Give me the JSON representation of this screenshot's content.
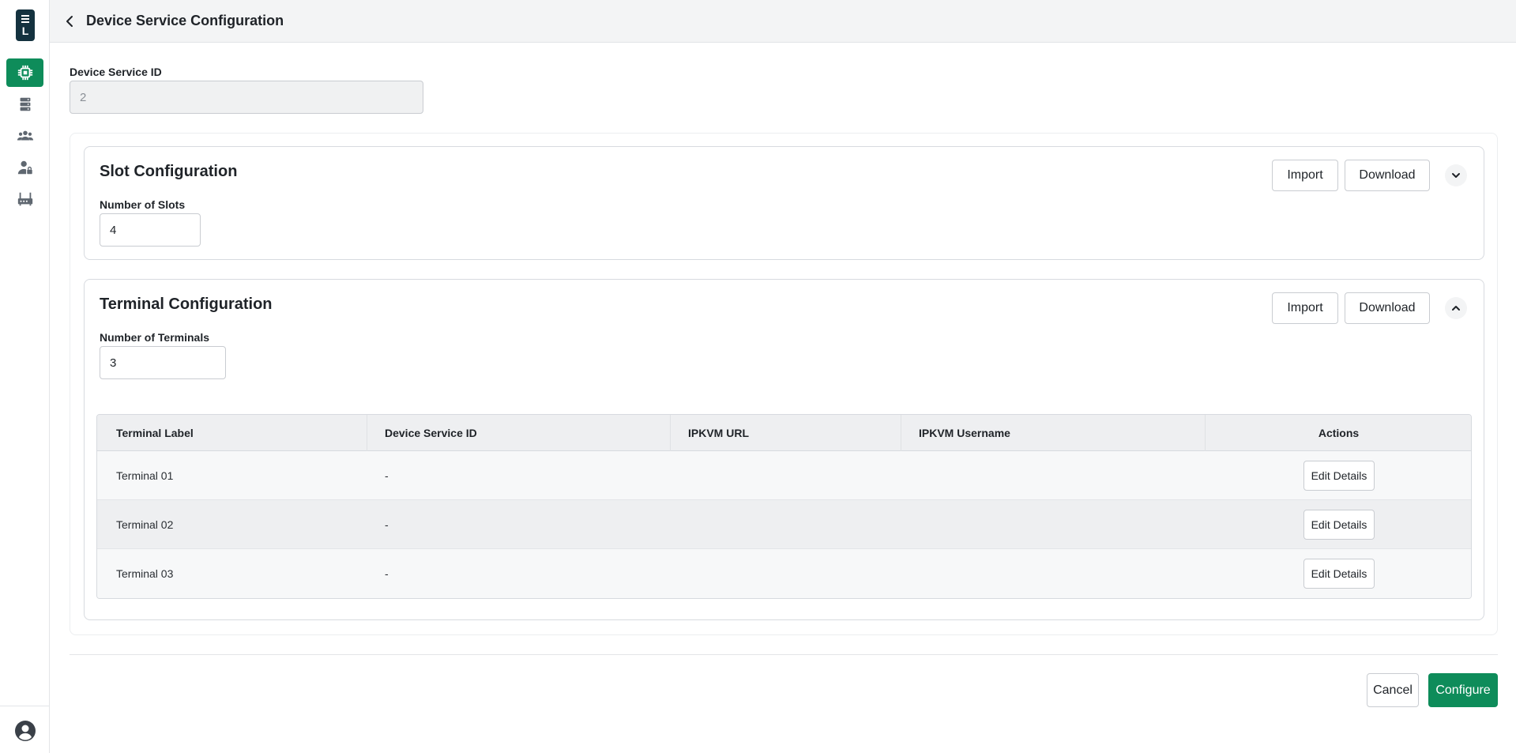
{
  "app": {
    "logo_letter": "L"
  },
  "sidebar": {
    "items": [
      {
        "icon": "chip-icon",
        "active": true
      },
      {
        "icon": "server-icon",
        "active": false
      },
      {
        "icon": "users-icon",
        "active": false
      },
      {
        "icon": "user-lock-icon",
        "active": false
      },
      {
        "icon": "router-icon",
        "active": false
      }
    ],
    "accent_color": "#0e8c5a"
  },
  "header": {
    "title": "Device Service Configuration"
  },
  "device_service": {
    "label": "Device Service ID",
    "value": "2"
  },
  "slot_config": {
    "title": "Slot Configuration",
    "import_label": "Import",
    "download_label": "Download",
    "count_label": "Number of Slots",
    "count_value": "4",
    "expanded": false
  },
  "terminal_config": {
    "title": "Terminal Configuration",
    "import_label": "Import",
    "download_label": "Download",
    "count_label": "Number of Terminals",
    "count_value": "3",
    "expanded": true,
    "table": {
      "headers": [
        "Terminal Label",
        "Device Service ID",
        "IPKVM URL",
        "IPKVM Username",
        "Actions"
      ],
      "rows": [
        {
          "label": "Terminal 01",
          "device_service_id": "-",
          "ipkvm_url": "",
          "ipkvm_username": "",
          "action": "Edit Details"
        },
        {
          "label": "Terminal 02",
          "device_service_id": "-",
          "ipkvm_url": "",
          "ipkvm_username": "",
          "action": "Edit Details"
        },
        {
          "label": "Terminal 03",
          "device_service_id": "-",
          "ipkvm_url": "",
          "ipkvm_username": "",
          "action": "Edit Details"
        }
      ]
    }
  },
  "footer": {
    "cancel_label": "Cancel",
    "configure_label": "Configure"
  }
}
